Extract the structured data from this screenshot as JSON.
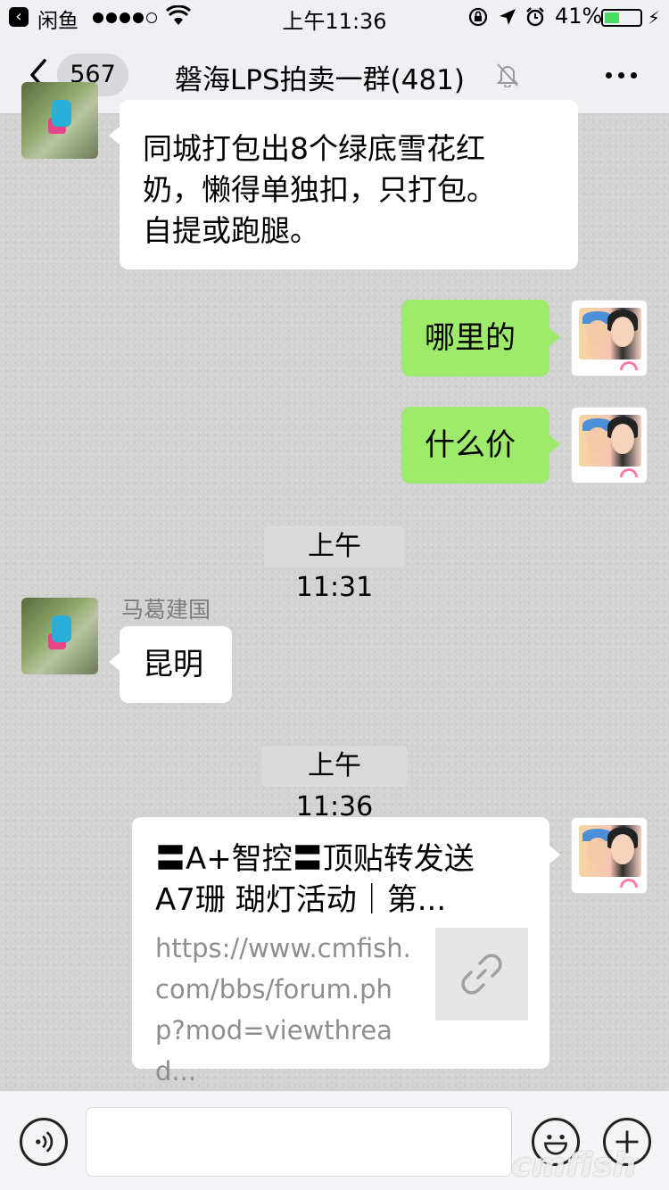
{
  "status_bar": {
    "app_back": "闲鱼",
    "time": "上午11:36",
    "battery": "41%",
    "battery_level": 0.41
  },
  "nav": {
    "unread_count": "567",
    "title": "磐海LPS拍卖一群(481)"
  },
  "messages": [
    {
      "side": "left",
      "text": "同城打包出8个绿底雪花红\n奶，懒得单独扣，只打包。\n自提或跑腿。"
    },
    {
      "side": "right",
      "text": "哪里的"
    },
    {
      "side": "right",
      "text": "什么价"
    },
    {
      "type": "timestamp",
      "text": "上午11:31"
    },
    {
      "side": "left",
      "sender": "马葛建国",
      "text": "昆明"
    },
    {
      "type": "timestamp",
      "text": "上午11:36"
    },
    {
      "side": "right",
      "type": "link",
      "title": "〓A+智控〓顶贴转发送\nA7珊 瑚灯活动｜第...",
      "url": "https://www.cmfish.com/bbs/forum.php?mod=viewthread..."
    }
  ],
  "input_bar": {
    "placeholder": ""
  },
  "watermark": "cmfish",
  "colors": {
    "self_bubble": "#9eea6a",
    "other_bubble": "#ffffff",
    "battery": "#4cd964"
  },
  "icons": {
    "back": "chevron-left-icon",
    "mute": "bell-slash-icon",
    "more": "more-dots-icon",
    "voice": "voice-icon",
    "emoji": "emoji-icon",
    "plus": "plus-icon",
    "link": "link-icon"
  }
}
